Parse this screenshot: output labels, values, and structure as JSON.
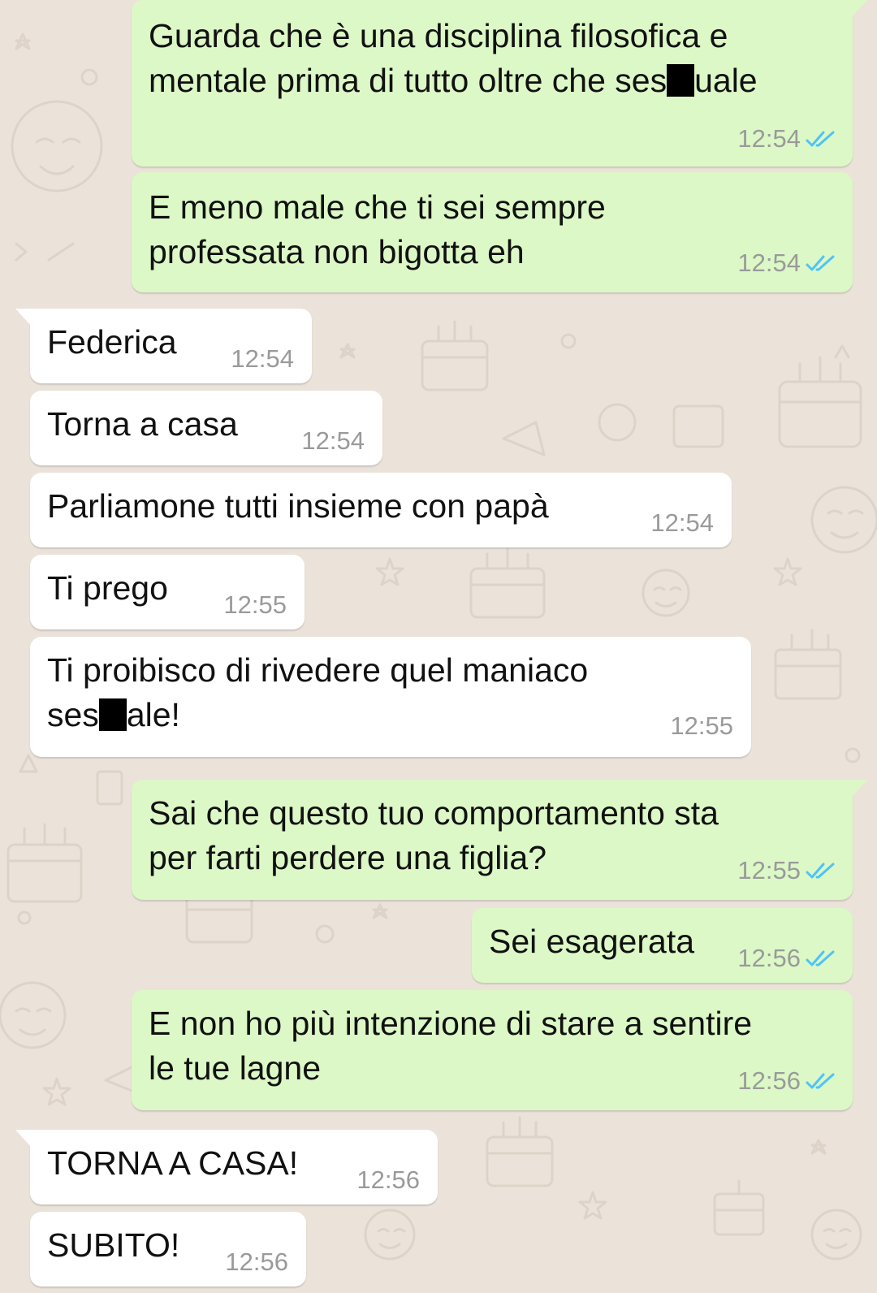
{
  "colors": {
    "background": "#ebe3da",
    "outgoing_bubble": "#dcf8c6",
    "incoming_bubble": "#ffffff",
    "read_ticks": "#4fc3f7",
    "timestamp": "#9a9a9a"
  },
  "messages": [
    {
      "direction": "out",
      "time": "12:54",
      "status": "read-double-check-icon",
      "lines": [
        "Guarda che è una disciplina filosofica e",
        "mentale prima di tutto oltre che ses█uale"
      ]
    },
    {
      "direction": "out",
      "time": "12:54",
      "status": "read-double-check-icon",
      "lines": [
        "E meno male che ti sei sempre",
        "professata non bigotta eh"
      ]
    },
    {
      "direction": "in",
      "time": "12:54",
      "lines": [
        "Federica"
      ]
    },
    {
      "direction": "in",
      "time": "12:54",
      "lines": [
        "Torna a casa"
      ]
    },
    {
      "direction": "in",
      "time": "12:54",
      "lines": [
        "Parliamone tutti insieme con papà"
      ]
    },
    {
      "direction": "in",
      "time": "12:55",
      "lines": [
        "Ti prego"
      ]
    },
    {
      "direction": "in",
      "time": "12:55",
      "lines": [
        "Ti proibisco di rivedere quel maniaco",
        "ses█ale!"
      ]
    },
    {
      "direction": "out",
      "time": "12:55",
      "status": "read-double-check-icon",
      "lines": [
        "Sai che questo tuo comportamento sta",
        "per farti perdere una figlia?"
      ]
    },
    {
      "direction": "out",
      "time": "12:56",
      "status": "read-double-check-icon",
      "lines": [
        "Sei esagerata"
      ]
    },
    {
      "direction": "out",
      "time": "12:56",
      "status": "read-double-check-icon",
      "lines": [
        "E non ho più intenzione di stare a sentire",
        "le tue lagne"
      ]
    },
    {
      "direction": "in",
      "time": "12:56",
      "lines": [
        "TORNA A CASA!"
      ]
    },
    {
      "direction": "in",
      "time": "12:56",
      "lines": [
        "SUBITO!"
      ]
    }
  ]
}
